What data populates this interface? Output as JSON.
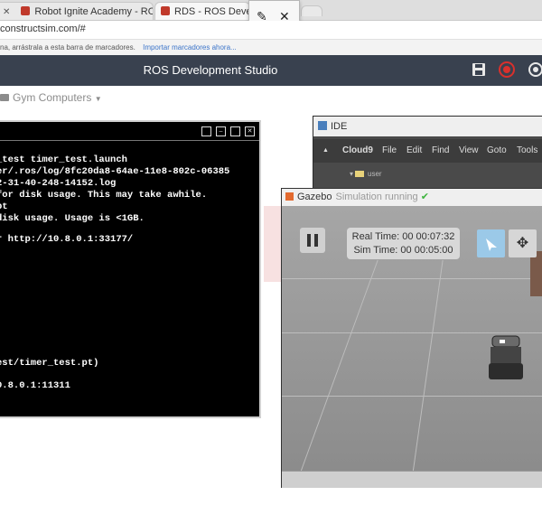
{
  "browser": {
    "tabs": [
      {
        "label": "Robot Ignite Academy - ROS I"
      },
      {
        "label": "RDS - ROS Develop"
      }
    ],
    "address": "constructsim.com/#",
    "bookmark_hint": "na, arrástrala a esta barra de marcadores.",
    "bookmark_import": "Importar marcadores ahora..."
  },
  "app": {
    "title": "ROS Development Studio",
    "gym_menu": "Gym Computers"
  },
  "terminal": {
    "lines": [
      "_test timer_test.launch",
      "er/.ros/log/8fc20da8-64ae-11e8-802c-06385",
      "2-31-40-248-14152.log",
      "for disk usage. This may take awhile.",
      "pt",
      "disk usage. Usage is <1GB.",
      "",
      "r http://10.8.0.1:33177/",
      "",
      "",
      "",
      "",
      "",
      "",
      "",
      "est/timer_test.pt)",
      "",
      "0.8.0.1:11311"
    ]
  },
  "ide": {
    "title": "IDE",
    "menu": [
      "Cloud9",
      "File",
      "Edit",
      "Find",
      "View",
      "Goto",
      "Tools"
    ],
    "tree_item": "user"
  },
  "gazebo": {
    "title": "Gazebo",
    "status": "Simulation running",
    "real_time": "Real Time: 00 00:07:32",
    "sim_time": "Sim Time: 00 00:05:00"
  },
  "colors": {
    "header_bg": "#39414f",
    "terminal_bg": "#000000",
    "ide_bg": "#3c3c3c",
    "selected_tool": "#9bc9e8",
    "record_red": "#d9302c"
  }
}
